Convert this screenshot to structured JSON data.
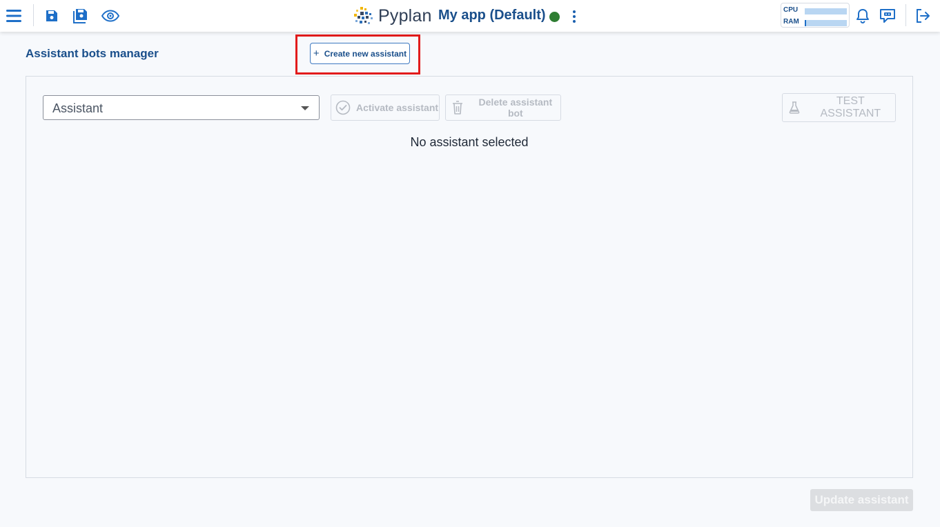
{
  "header": {
    "brand_name": "Pyplan",
    "app_title": "My app (Default)",
    "status_color": "#2e7d32",
    "resources": {
      "cpu_label": "CPU",
      "cpu_usage": 0.0,
      "ram_label": "RAM",
      "ram_usage": 0.04
    }
  },
  "page": {
    "title": "Assistant bots manager",
    "create_label": "Create new assistant",
    "assistant_select": {
      "value": "Assistant"
    },
    "activate_label": "Activate assistant",
    "delete_label": "Delete assistant bot",
    "test_label": "TEST ASSISTANT",
    "empty_message": "No assistant selected",
    "update_label": "Update assistant"
  },
  "colors": {
    "accent": "#1a4f8b",
    "icon_blue": "#1e6fc8",
    "highlight": "#e21b1b"
  }
}
